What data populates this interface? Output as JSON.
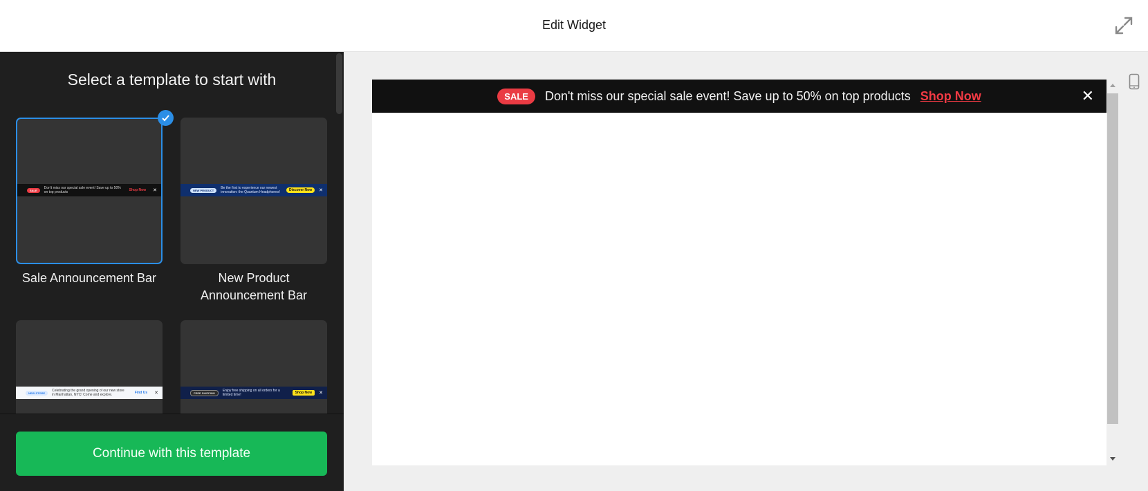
{
  "header": {
    "title": "Edit Widget",
    "expand_icon": "expand-arrows-icon"
  },
  "left_panel": {
    "title": "Select a template to start with",
    "templates": [
      {
        "label": "Sale Announcement Bar",
        "selected": true,
        "preview": {
          "badge": "SALE",
          "text": "Don't miss our special sale event! Save up to 50% on top products",
          "cta": "Shop Now",
          "bar_color": "#111111",
          "badge_color": "#ea3b43",
          "cta_color": "#ea3b43",
          "text_color": "#dddddd"
        }
      },
      {
        "label": "New Product Announcement Bar",
        "selected": false,
        "preview": {
          "badge": "NEW PRODUCT",
          "text": "Be the first to experience our newest innovation: the Quantum Headphones!",
          "cta": "Discover Now",
          "bar_color": "#0f2f6e",
          "badge_color": "#cfe3ff",
          "cta_color": "#ffe21a",
          "text_color": "#e0e8ff"
        }
      },
      {
        "label": "",
        "selected": false,
        "preview": {
          "badge": "NEW STORE",
          "text": "Celebrating the grand opening of our new store in Manhattan, NYC! Come and explore.",
          "cta": "Find Us",
          "bar_color": "#f5f7fa",
          "badge_color": "#d8e8ff",
          "cta_color": "#2b7de9",
          "text_color": "#333333"
        }
      },
      {
        "label": "",
        "selected": false,
        "preview": {
          "badge": "FREE SHIPPING",
          "text": "Enjoy free shipping on all orders for a limited time!",
          "cta": "Shop Now",
          "bar_color": "#10204a",
          "badge_color": "#2a2a2a",
          "cta_color": "#ffe21a",
          "text_color": "#e0e8ff"
        }
      }
    ],
    "continue_button": "Continue with this template"
  },
  "preview": {
    "badge": "SALE",
    "message": "Don't miss our special sale event! Save up to 50% on top products",
    "cta": "Shop Now",
    "close": "✕",
    "device_icon": "mobile-device-icon",
    "colors": {
      "bar": "#111111",
      "badge": "#ea3b43",
      "cta": "#f23a44",
      "accent_selected": "#2b8ee6",
      "continue_button": "#17b857"
    }
  }
}
